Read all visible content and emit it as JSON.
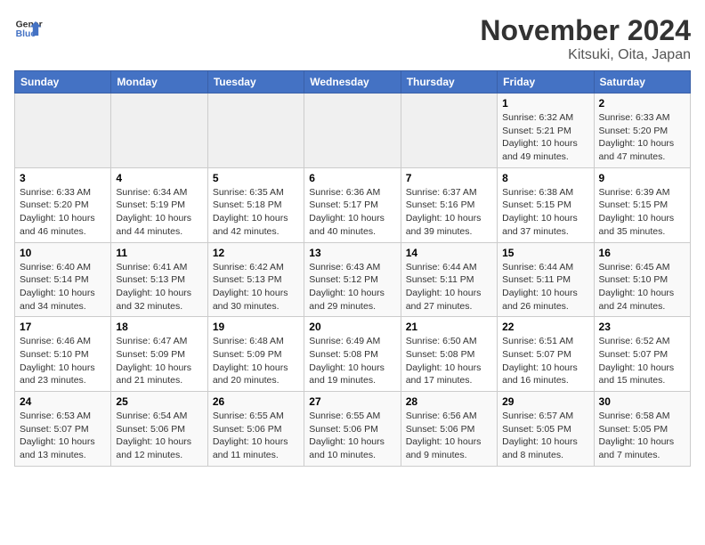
{
  "header": {
    "logo_line1": "General",
    "logo_line2": "Blue",
    "title": "November 2024",
    "subtitle": "Kitsuki, Oita, Japan"
  },
  "columns": [
    "Sunday",
    "Monday",
    "Tuesday",
    "Wednesday",
    "Thursday",
    "Friday",
    "Saturday"
  ],
  "weeks": [
    [
      {
        "day": "",
        "detail": ""
      },
      {
        "day": "",
        "detail": ""
      },
      {
        "day": "",
        "detail": ""
      },
      {
        "day": "",
        "detail": ""
      },
      {
        "day": "",
        "detail": ""
      },
      {
        "day": "1",
        "detail": "Sunrise: 6:32 AM\nSunset: 5:21 PM\nDaylight: 10 hours and 49 minutes."
      },
      {
        "day": "2",
        "detail": "Sunrise: 6:33 AM\nSunset: 5:20 PM\nDaylight: 10 hours and 47 minutes."
      }
    ],
    [
      {
        "day": "3",
        "detail": "Sunrise: 6:33 AM\nSunset: 5:20 PM\nDaylight: 10 hours and 46 minutes."
      },
      {
        "day": "4",
        "detail": "Sunrise: 6:34 AM\nSunset: 5:19 PM\nDaylight: 10 hours and 44 minutes."
      },
      {
        "day": "5",
        "detail": "Sunrise: 6:35 AM\nSunset: 5:18 PM\nDaylight: 10 hours and 42 minutes."
      },
      {
        "day": "6",
        "detail": "Sunrise: 6:36 AM\nSunset: 5:17 PM\nDaylight: 10 hours and 40 minutes."
      },
      {
        "day": "7",
        "detail": "Sunrise: 6:37 AM\nSunset: 5:16 PM\nDaylight: 10 hours and 39 minutes."
      },
      {
        "day": "8",
        "detail": "Sunrise: 6:38 AM\nSunset: 5:15 PM\nDaylight: 10 hours and 37 minutes."
      },
      {
        "day": "9",
        "detail": "Sunrise: 6:39 AM\nSunset: 5:15 PM\nDaylight: 10 hours and 35 minutes."
      }
    ],
    [
      {
        "day": "10",
        "detail": "Sunrise: 6:40 AM\nSunset: 5:14 PM\nDaylight: 10 hours and 34 minutes."
      },
      {
        "day": "11",
        "detail": "Sunrise: 6:41 AM\nSunset: 5:13 PM\nDaylight: 10 hours and 32 minutes."
      },
      {
        "day": "12",
        "detail": "Sunrise: 6:42 AM\nSunset: 5:13 PM\nDaylight: 10 hours and 30 minutes."
      },
      {
        "day": "13",
        "detail": "Sunrise: 6:43 AM\nSunset: 5:12 PM\nDaylight: 10 hours and 29 minutes."
      },
      {
        "day": "14",
        "detail": "Sunrise: 6:44 AM\nSunset: 5:11 PM\nDaylight: 10 hours and 27 minutes."
      },
      {
        "day": "15",
        "detail": "Sunrise: 6:44 AM\nSunset: 5:11 PM\nDaylight: 10 hours and 26 minutes."
      },
      {
        "day": "16",
        "detail": "Sunrise: 6:45 AM\nSunset: 5:10 PM\nDaylight: 10 hours and 24 minutes."
      }
    ],
    [
      {
        "day": "17",
        "detail": "Sunrise: 6:46 AM\nSunset: 5:10 PM\nDaylight: 10 hours and 23 minutes."
      },
      {
        "day": "18",
        "detail": "Sunrise: 6:47 AM\nSunset: 5:09 PM\nDaylight: 10 hours and 21 minutes."
      },
      {
        "day": "19",
        "detail": "Sunrise: 6:48 AM\nSunset: 5:09 PM\nDaylight: 10 hours and 20 minutes."
      },
      {
        "day": "20",
        "detail": "Sunrise: 6:49 AM\nSunset: 5:08 PM\nDaylight: 10 hours and 19 minutes."
      },
      {
        "day": "21",
        "detail": "Sunrise: 6:50 AM\nSunset: 5:08 PM\nDaylight: 10 hours and 17 minutes."
      },
      {
        "day": "22",
        "detail": "Sunrise: 6:51 AM\nSunset: 5:07 PM\nDaylight: 10 hours and 16 minutes."
      },
      {
        "day": "23",
        "detail": "Sunrise: 6:52 AM\nSunset: 5:07 PM\nDaylight: 10 hours and 15 minutes."
      }
    ],
    [
      {
        "day": "24",
        "detail": "Sunrise: 6:53 AM\nSunset: 5:07 PM\nDaylight: 10 hours and 13 minutes."
      },
      {
        "day": "25",
        "detail": "Sunrise: 6:54 AM\nSunset: 5:06 PM\nDaylight: 10 hours and 12 minutes."
      },
      {
        "day": "26",
        "detail": "Sunrise: 6:55 AM\nSunset: 5:06 PM\nDaylight: 10 hours and 11 minutes."
      },
      {
        "day": "27",
        "detail": "Sunrise: 6:55 AM\nSunset: 5:06 PM\nDaylight: 10 hours and 10 minutes."
      },
      {
        "day": "28",
        "detail": "Sunrise: 6:56 AM\nSunset: 5:06 PM\nDaylight: 10 hours and 9 minutes."
      },
      {
        "day": "29",
        "detail": "Sunrise: 6:57 AM\nSunset: 5:05 PM\nDaylight: 10 hours and 8 minutes."
      },
      {
        "day": "30",
        "detail": "Sunrise: 6:58 AM\nSunset: 5:05 PM\nDaylight: 10 hours and 7 minutes."
      }
    ]
  ]
}
